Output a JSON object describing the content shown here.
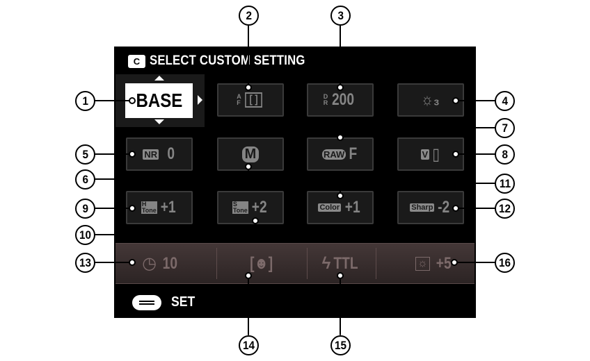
{
  "header": {
    "icon": "custom-setting-return-icon",
    "icon_glyph": "C",
    "title": "SELECT CUSTOM SETTING"
  },
  "base": {
    "label": "BASE"
  },
  "settings": {
    "af_mode": {
      "top": "A",
      "bottom": "F",
      "frame": "[ ]"
    },
    "dynamic_range": {
      "top": "D",
      "bottom": "R",
      "value": "200"
    },
    "white_balance": {
      "icon": "white-balance-fluorescent-icon",
      "glyph": "☼₃"
    },
    "noise_reduction": {
      "tag": "NR",
      "value": "0"
    },
    "shooting_mode": {
      "value": "M"
    },
    "raw_quality": {
      "tag": "RAW",
      "value": "F"
    },
    "film_simulation": {
      "tag": "V",
      "icon": "film-icon",
      "glyph": "▯"
    },
    "highlight_tone": {
      "top": "H",
      "bottom": "Tone",
      "value": "+1"
    },
    "shadow_tone": {
      "top": "S",
      "bottom": "Tone",
      "value": "+2"
    },
    "color": {
      "tag": "Color",
      "value": "+1"
    },
    "sharpness": {
      "tag": "Sharp",
      "value": "-2"
    }
  },
  "bar": {
    "self_timer": {
      "icon": "self-timer-icon",
      "glyph": "◷",
      "value": "10"
    },
    "face_detection": {
      "icon": "face-detection-icon",
      "glyph": "[☻]"
    },
    "flash": {
      "icon": "flash-icon",
      "glyph": "ϟ",
      "value": "TTL"
    },
    "brightness": {
      "icon": "brightness-icon",
      "glyph": "☼",
      "value": "+5"
    }
  },
  "footer": {
    "icon": "command-dial-icon",
    "label": "SET"
  },
  "callouts": [
    "1",
    "2",
    "3",
    "4",
    "5",
    "6",
    "7",
    "8",
    "9",
    "10",
    "11",
    "12",
    "13",
    "14",
    "15",
    "16"
  ],
  "colors": {
    "screen": "#000000",
    "selected": "#ffffff",
    "dim_text": "#858585",
    "bar": "#3a2f2f"
  }
}
